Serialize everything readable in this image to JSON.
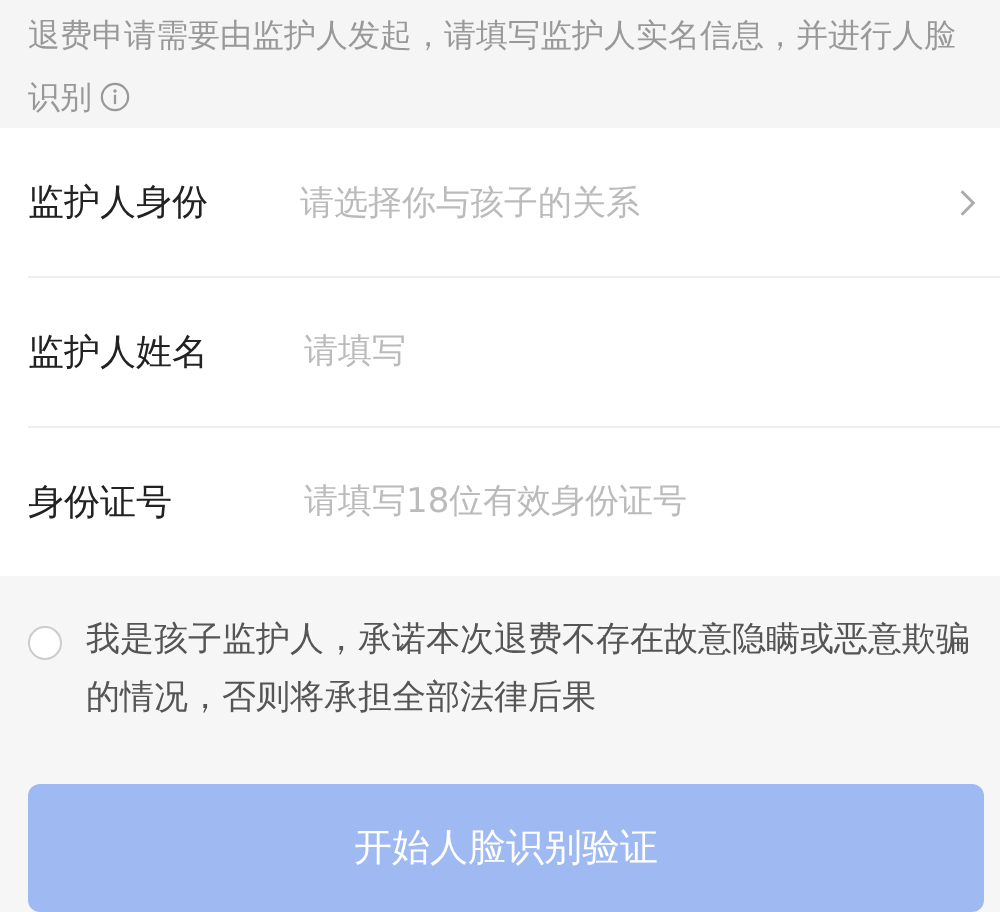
{
  "notice": {
    "text": "退费申请需要由监护人发起，请填写监护人实名信息，并进行人脸识别"
  },
  "fields": [
    {
      "kind": "select",
      "label": "监护人身份",
      "placeholder": "请选择你与孩子的关系"
    },
    {
      "kind": "input",
      "label": "监护人姓名",
      "placeholder": "请填写"
    },
    {
      "kind": "input",
      "label": "身份证号",
      "placeholder": "请填写18位有效身份证号"
    }
  ],
  "agreement": {
    "checked": false,
    "text": "我是孩子监护人，承诺本次退费不存在故意隐瞒或恶意欺骗的情况，否则将承担全部法律后果"
  },
  "submit_button": {
    "label": "开始人脸识别验证",
    "disabled": true
  }
}
